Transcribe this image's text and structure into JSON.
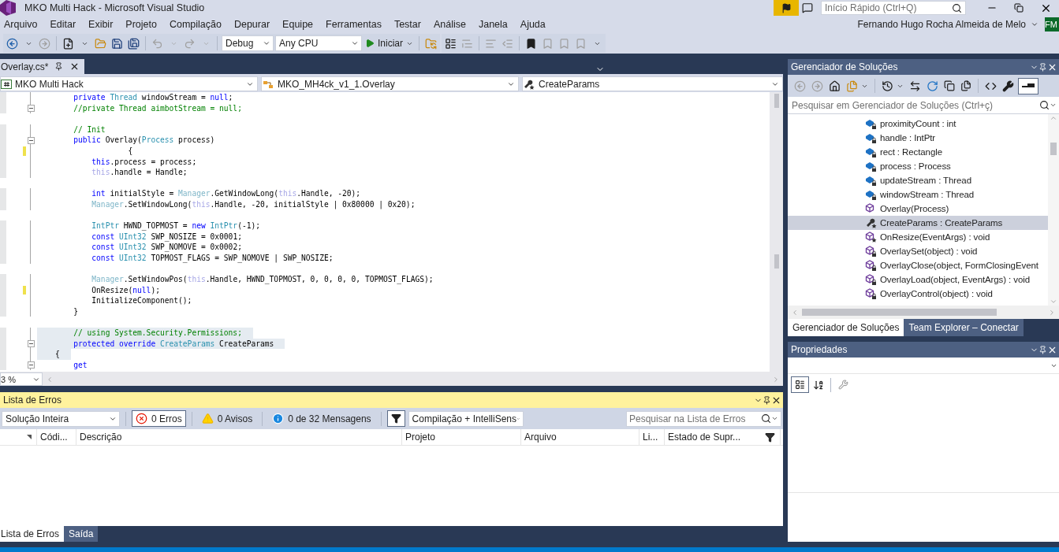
{
  "window": {
    "title": "MKO Multi Hack - Microsoft Visual Studio",
    "quick_launch": {
      "placeholder": "Início Rápido (Ctrl+Q)"
    }
  },
  "menu": [
    "Arquivo",
    "Editar",
    "Exibir",
    "Projeto",
    "Compilação",
    "Depurar",
    "Equipe",
    "Ferramentas",
    "Testar",
    "Análise",
    "Janela",
    "Ajuda"
  ],
  "user": {
    "name": "Fernando Hugo Rocha Almeida de Melo",
    "initials": "FM"
  },
  "toolbar": {
    "configuration": "Debug",
    "platform": "Any CPU",
    "start": "Iniciar"
  },
  "editor": {
    "tabs": [
      {
        "label": "Overlay.cs*",
        "selected": true
      }
    ],
    "nav": [
      "MKO Multi Hack",
      "MKO_MH4ck_v1_1.Overlay",
      "CreateParams"
    ],
    "lines": [
      {
        "kind": "code",
        "changed": false,
        "fold": false,
        "highlighted": false,
        "tokens": [
          {
            "kind": "keyword",
            "text": "        private"
          },
          {
            "kind": "type",
            "text": " Thread"
          },
          {
            "kind": "plain",
            "text": " windowStream = "
          },
          {
            "kind": "keyword",
            "text": "null"
          },
          {
            "kind": "plain",
            "text": ";"
          }
        ]
      },
      {
        "kind": "code",
        "changed": false,
        "fold": true,
        "highlighted": false,
        "tokens": [
          {
            "kind": "comment",
            "text": "        //private Thread aimbotStream = null;"
          }
        ]
      },
      {
        "kind": "blank"
      },
      {
        "kind": "code",
        "changed": false,
        "fold": false,
        "highlighted": false,
        "tokens": [
          {
            "kind": "comment",
            "text": "        // Init"
          }
        ]
      },
      {
        "kind": "code",
        "changed": false,
        "fold": true,
        "highlighted": false,
        "tokens": [
          {
            "kind": "keyword",
            "text": "        public"
          },
          {
            "kind": "plain",
            "text": " Overlay("
          },
          {
            "kind": "type",
            "text": "Process"
          },
          {
            "kind": "plain",
            "text": " process)"
          }
        ]
      },
      {
        "kind": "code",
        "changed": true,
        "fold": false,
        "highlighted": false,
        "tokens": [
          {
            "kind": "plain",
            "text": "                    {"
          }
        ]
      },
      {
        "kind": "code",
        "changed": false,
        "fold": false,
        "highlighted": false,
        "tokens": [
          {
            "kind": "keyword",
            "text": "            this"
          },
          {
            "kind": "plain",
            "text": ".process = process;"
          }
        ]
      },
      {
        "kind": "code",
        "changed": false,
        "fold": false,
        "highlighted": false,
        "tokens": [
          {
            "kind": "faded-keyword",
            "text": "            this"
          },
          {
            "kind": "plain",
            "text": ".handle = Handle;"
          }
        ]
      },
      {
        "kind": "blank"
      },
      {
        "kind": "code",
        "changed": false,
        "fold": false,
        "highlighted": false,
        "tokens": [
          {
            "kind": "keyword",
            "text": "            int"
          },
          {
            "kind": "plain",
            "text": " initialStyle = "
          },
          {
            "kind": "faded-type",
            "text": "Manager"
          },
          {
            "kind": "plain",
            "text": ".GetWindowLong("
          },
          {
            "kind": "faded-keyword",
            "text": "this"
          },
          {
            "kind": "plain",
            "text": ".Handle, -20);"
          }
        ]
      },
      {
        "kind": "code",
        "changed": false,
        "fold": false,
        "highlighted": false,
        "tokens": [
          {
            "kind": "faded-type",
            "text": "            Manager"
          },
          {
            "kind": "plain",
            "text": ".SetWindowLong("
          },
          {
            "kind": "faded-keyword",
            "text": "this"
          },
          {
            "kind": "plain",
            "text": ".Handle, -20, initialStyle | 0x80000 | 0x20);"
          }
        ]
      },
      {
        "kind": "blank"
      },
      {
        "kind": "code",
        "changed": false,
        "fold": false,
        "highlighted": false,
        "tokens": [
          {
            "kind": "type",
            "text": "            IntPtr"
          },
          {
            "kind": "plain",
            "text": " HWND_TOPMOST = "
          },
          {
            "kind": "keyword",
            "text": "new"
          },
          {
            "kind": "type",
            "text": " IntPtr"
          },
          {
            "kind": "plain",
            "text": "(-1);"
          }
        ]
      },
      {
        "kind": "code",
        "changed": false,
        "fold": false,
        "highlighted": false,
        "tokens": [
          {
            "kind": "keyword",
            "text": "            const"
          },
          {
            "kind": "type",
            "text": " UInt32"
          },
          {
            "kind": "plain",
            "text": " SWP_NOSIZE = 0x0001;"
          }
        ]
      },
      {
        "kind": "code",
        "changed": false,
        "fold": false,
        "highlighted": false,
        "tokens": [
          {
            "kind": "keyword",
            "text": "            const"
          },
          {
            "kind": "type",
            "text": " UInt32"
          },
          {
            "kind": "plain",
            "text": " SWP_NOMOVE = 0x0002;"
          }
        ]
      },
      {
        "kind": "code",
        "changed": false,
        "fold": false,
        "highlighted": false,
        "tokens": [
          {
            "kind": "keyword",
            "text": "            const"
          },
          {
            "kind": "type",
            "text": " UInt32"
          },
          {
            "kind": "plain",
            "text": " TOPMOST_FLAGS = SWP_NOMOVE | SWP_NOSIZE;"
          }
        ]
      },
      {
        "kind": "blank"
      },
      {
        "kind": "code",
        "changed": false,
        "fold": false,
        "highlighted": false,
        "tokens": [
          {
            "kind": "faded-type",
            "text": "            Manager"
          },
          {
            "kind": "plain",
            "text": ".SetWindowPos("
          },
          {
            "kind": "faded-keyword",
            "text": "this"
          },
          {
            "kind": "plain",
            "text": ".Handle, HWND_TOPMOST, 0, 0, 0, 0, TOPMOST_FLAGS);"
          }
        ]
      },
      {
        "kind": "code",
        "changed": true,
        "fold": false,
        "highlighted": false,
        "tokens": [
          {
            "kind": "plain",
            "text": "            OnResize("
          },
          {
            "kind": "keyword",
            "text": "null"
          },
          {
            "kind": "plain",
            "text": ");"
          }
        ]
      },
      {
        "kind": "code",
        "changed": false,
        "fold": false,
        "highlighted": false,
        "tokens": [
          {
            "kind": "plain",
            "text": "            InitializeComponent();"
          }
        ]
      },
      {
        "kind": "code",
        "changed": false,
        "fold": false,
        "highlighted": false,
        "tokens": [
          {
            "kind": "plain",
            "text": "        }"
          }
        ]
      },
      {
        "kind": "blank"
      },
      {
        "kind": "code",
        "changed": false,
        "fold": false,
        "highlighted": true,
        "tokens": [
          {
            "kind": "comment",
            "text": "        // using System.Security.Permissions;"
          }
        ]
      },
      {
        "kind": "code",
        "changed": false,
        "fold": true,
        "highlighted": true,
        "tokens": [
          {
            "kind": "keyword",
            "text": "        protected"
          },
          {
            "kind": "keyword",
            "text": " override"
          },
          {
            "kind": "type",
            "text": " CreateParams"
          },
          {
            "kind": "plain",
            "text": " CreateParams"
          }
        ]
      },
      {
        "kind": "code",
        "changed": false,
        "fold": false,
        "highlighted": true,
        "tokens": [
          {
            "kind": "plain",
            "text": "    {"
          }
        ]
      },
      {
        "kind": "code",
        "changed": false,
        "fold": true,
        "highlighted": false,
        "tokens": [
          {
            "kind": "keyword",
            "text": "        get"
          }
        ]
      }
    ],
    "zoom": "3 %"
  },
  "error_list": {
    "title": "Lista de Erros",
    "scope": "Solução Inteira",
    "filters": [
      {
        "kind": "error",
        "label": "0 Erros",
        "selected": true
      },
      {
        "kind": "warning",
        "label": "0 Avisos",
        "selected": false
      },
      {
        "kind": "info",
        "label": "0 de 32 Mensagens",
        "selected": false
      }
    ],
    "source": "Compilação + IntelliSens",
    "search": {
      "placeholder": "Pesquisar na Lista de Erros"
    },
    "columns": [
      "Códi...",
      "Descrição",
      "Projeto",
      "Arquivo",
      "Li...",
      "Estado de Supr..."
    ]
  },
  "bottom_tabs": [
    {
      "label": "Lista de Erros",
      "selected": true
    },
    {
      "label": "Saída",
      "selected": false
    }
  ],
  "solution_explorer": {
    "title": "Gerenciador de Soluções",
    "search": {
      "placeholder": "Pesquisar em Gerenciador de Soluções (Ctrl+ç)"
    },
    "items": [
      {
        "kind": "private-field",
        "label": "proximityCount : int",
        "selected": false
      },
      {
        "kind": "private-field",
        "label": "handle : IntPtr",
        "selected": false
      },
      {
        "kind": "private-field",
        "label": "rect : Rectangle",
        "selected": false
      },
      {
        "kind": "private-field",
        "label": "process : Process",
        "selected": false
      },
      {
        "kind": "private-field",
        "label": "updateStream : Thread",
        "selected": false
      },
      {
        "kind": "private-field",
        "label": "windowStream : Thread",
        "selected": false
      },
      {
        "kind": "public-method",
        "label": "Overlay(Process)",
        "selected": false
      },
      {
        "kind": "protected-property",
        "label": "CreateParams : CreateParams",
        "selected": true
      },
      {
        "kind": "protected-method",
        "label": "OnResize(EventArgs) : void",
        "selected": false
      },
      {
        "kind": "private-method",
        "label": "OverlaySet(object) : void",
        "selected": false
      },
      {
        "kind": "private-method",
        "label": "OverlayClose(object, FormClosingEvent",
        "selected": false
      },
      {
        "kind": "private-method",
        "label": "OverlayLoad(object, EventArgs) : void",
        "selected": false
      },
      {
        "kind": "private-method",
        "label": "OverlayControl(object) : void",
        "selected": false
      }
    ],
    "tabs": [
      {
        "label": "Gerenciador de Soluções",
        "selected": true
      },
      {
        "label": "Team Explorer – Conectar",
        "selected": false
      }
    ]
  },
  "properties": {
    "title": "Propriedades"
  }
}
